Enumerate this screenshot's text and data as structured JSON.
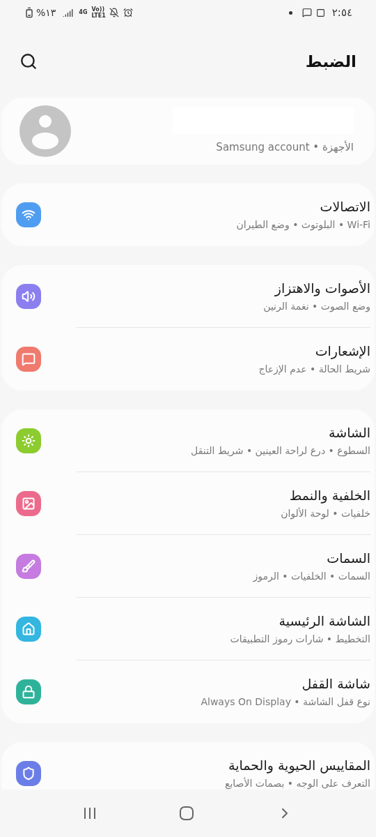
{
  "status_bar": {
    "battery": "%١٣",
    "network": "4G",
    "volte": "Vo))",
    "lte": "LTE1",
    "time": "٢:٥٤"
  },
  "header": {
    "title": "الضبط"
  },
  "account": {
    "subtitle": "الأجهزة • Samsung account"
  },
  "groups": [
    {
      "items": [
        {
          "title": "الاتصالات",
          "subtitle": "Wi-Fi • البلوتوث • وضع الطيران",
          "color": "#4f9df0"
        }
      ]
    },
    {
      "items": [
        {
          "title": "الأصوات والاهتزاز",
          "subtitle": "وضع الصوت • نغمة الرنين",
          "color": "#8b7ff0"
        },
        {
          "title": "الإشعارات",
          "subtitle": "شريط الحالة • عدم الإزعاج",
          "color": "#f07a6e"
        }
      ]
    },
    {
      "items": [
        {
          "title": "الشاشة",
          "subtitle": "السطوع • درع لراحة العينين • شريط التنقل",
          "color": "#8ccc2e"
        },
        {
          "title": "الخلفية والنمط",
          "subtitle": "خلفيات • لوحة الألوان",
          "color": "#ec6b8c"
        },
        {
          "title": "السمات",
          "subtitle": "السمات • الخلفيات • الرموز",
          "color": "#c57be0"
        },
        {
          "title": "الشاشة الرئيسية",
          "subtitle": "التخطيط • شارات رموز التطبيقات",
          "color": "#33b6e0"
        },
        {
          "title": "شاشة القفل",
          "subtitle": "نوع قفل الشاشة • Always On Display",
          "color": "#2eb39a"
        }
      ]
    },
    {
      "items": [
        {
          "title": "المقاييس الحيوية والحماية",
          "subtitle": "التعرف على الوجه • بصمات الأصابع",
          "color": "#6b7ee8"
        }
      ]
    }
  ]
}
